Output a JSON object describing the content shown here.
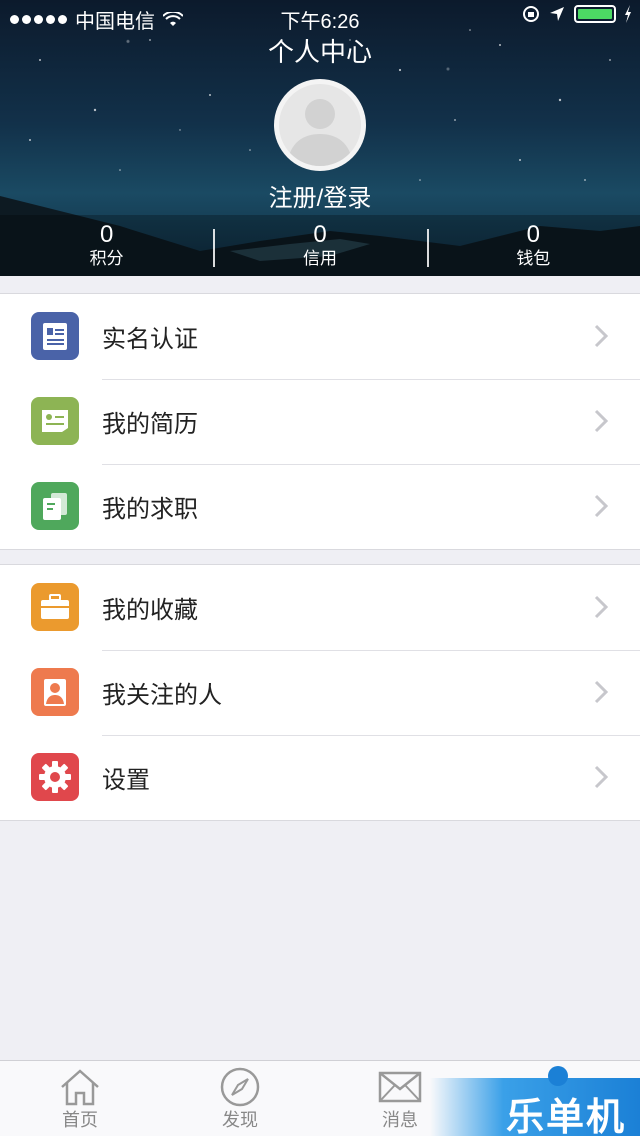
{
  "status_bar": {
    "carrier": "中国电信",
    "time": "下午6:26"
  },
  "header": {
    "title": "个人中心",
    "login_label": "注册/登录"
  },
  "stats": [
    {
      "value": "0",
      "label": "积分"
    },
    {
      "value": "0",
      "label": "信用"
    },
    {
      "value": "0",
      "label": "钱包"
    }
  ],
  "menu_group_1": [
    {
      "label": "实名认证",
      "icon": "id-card-icon",
      "color": "#4a63a8"
    },
    {
      "label": "我的简历",
      "icon": "resume-icon",
      "color": "#8db454"
    },
    {
      "label": "我的求职",
      "icon": "job-search-icon",
      "color": "#4fa85c"
    }
  ],
  "menu_group_2": [
    {
      "label": "我的收藏",
      "icon": "briefcase-icon",
      "color": "#eb9a2e"
    },
    {
      "label": "我关注的人",
      "icon": "person-icon",
      "color": "#ee7a4e"
    },
    {
      "label": "设置",
      "icon": "gear-icon",
      "color": "#e0474c"
    }
  ],
  "tabbar": [
    {
      "label": "首页",
      "icon": "home-icon"
    },
    {
      "label": "发现",
      "icon": "compass-icon"
    },
    {
      "label": "消息",
      "icon": "mail-icon"
    },
    {
      "label": "",
      "icon": ""
    }
  ],
  "watermark": "乐单机"
}
